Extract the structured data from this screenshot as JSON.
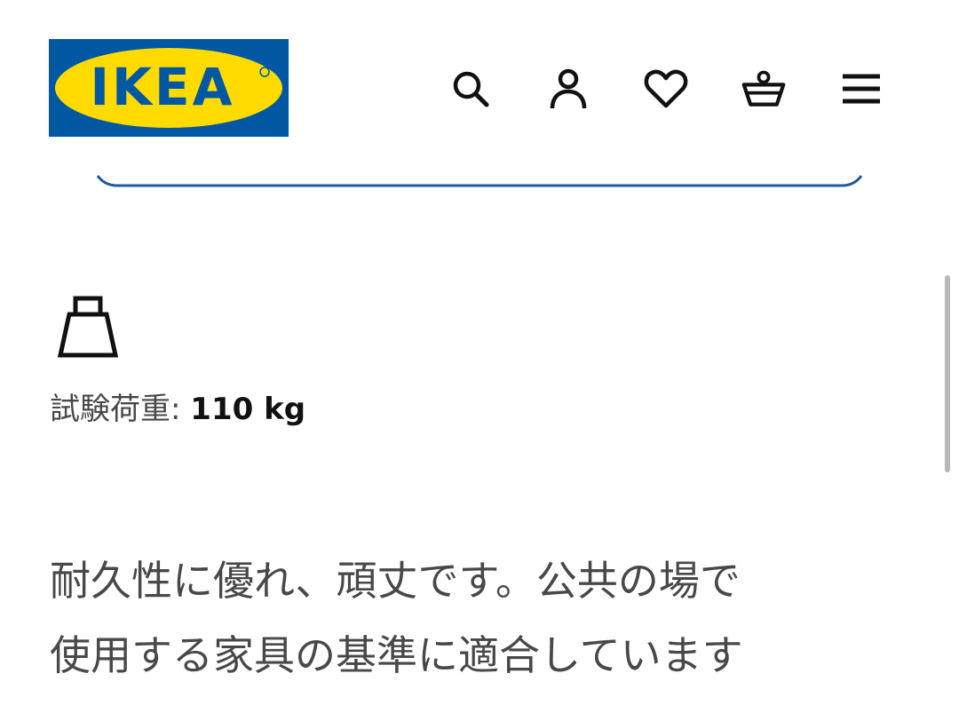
{
  "header": {
    "logo_text": "IKEA",
    "brand_colors": {
      "blue": "#0058a3",
      "yellow": "#ffdb00"
    },
    "icons": [
      "search-icon",
      "account-icon",
      "heart-icon",
      "basket-icon",
      "menu-icon"
    ]
  },
  "product": {
    "weight_icon": "weight-icon",
    "load_label": "試験荷重:",
    "load_value": "110 kg",
    "description_line1": "耐久性に優れ、頑丈です。公共の場で",
    "description_line2": "使用する家具の基準に適合しています"
  },
  "colors": {
    "divider": "#1f5aa0",
    "text_secondary": "#484848",
    "text_primary": "#111111"
  }
}
